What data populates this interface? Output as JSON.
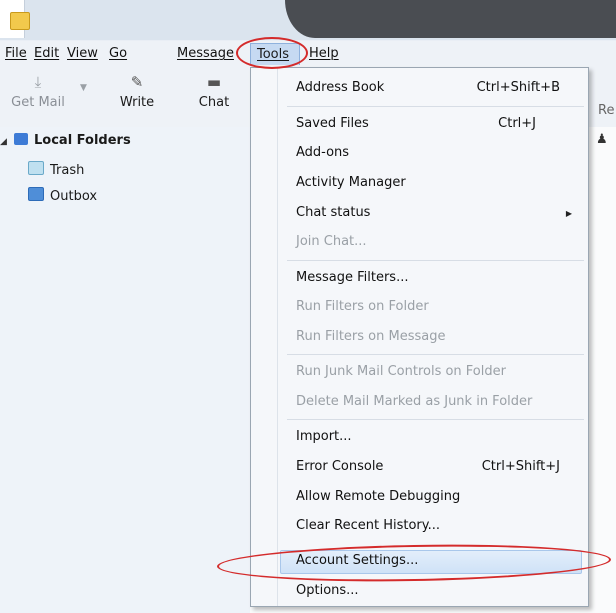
{
  "menubar": {
    "items": [
      "File",
      "Edit",
      "View",
      "Go",
      "Message",
      "Tools",
      "Help"
    ]
  },
  "toolbar": {
    "get_mail": "Get Mail",
    "write": "Write",
    "chat": "Chat",
    "right_cut_label": "Re"
  },
  "folders": {
    "root": "Local Folders",
    "items": [
      "Trash",
      "Outbox"
    ]
  },
  "tools_menu": {
    "items": [
      {
        "label": "Address Book",
        "shortcut": "Ctrl+Shift+B",
        "disabled": false
      },
      {
        "label": "Saved Files",
        "shortcut": "Ctrl+J",
        "disabled": false
      },
      {
        "label": "Add-ons",
        "shortcut": "",
        "disabled": false
      },
      {
        "label": "Activity Manager",
        "shortcut": "",
        "disabled": false
      },
      {
        "label": "Chat status",
        "shortcut": "",
        "disabled": false
      },
      {
        "label": "Join Chat...",
        "shortcut": "",
        "disabled": true
      },
      {
        "label": "Message Filters...",
        "shortcut": "",
        "disabled": false
      },
      {
        "label": "Run Filters on Folder",
        "shortcut": "",
        "disabled": true
      },
      {
        "label": "Run Filters on Message",
        "shortcut": "",
        "disabled": true
      },
      {
        "label": "Run Junk Mail Controls on Folder",
        "shortcut": "",
        "disabled": true
      },
      {
        "label": "Delete Mail Marked as Junk in Folder",
        "shortcut": "",
        "disabled": true
      },
      {
        "label": "Import...",
        "shortcut": "",
        "disabled": false
      },
      {
        "label": "Error Console",
        "shortcut": "Ctrl+Shift+J",
        "disabled": false
      },
      {
        "label": "Allow Remote Debugging",
        "shortcut": "",
        "disabled": false
      },
      {
        "label": "Clear Recent History...",
        "shortcut": "",
        "disabled": false
      },
      {
        "label": "Account Settings...",
        "shortcut": "",
        "disabled": false
      },
      {
        "label": "Options...",
        "shortcut": "",
        "disabled": false
      }
    ]
  },
  "colors": {
    "highlight_circle": "#d42b2b",
    "menu_hover": "#cfe2f7"
  }
}
